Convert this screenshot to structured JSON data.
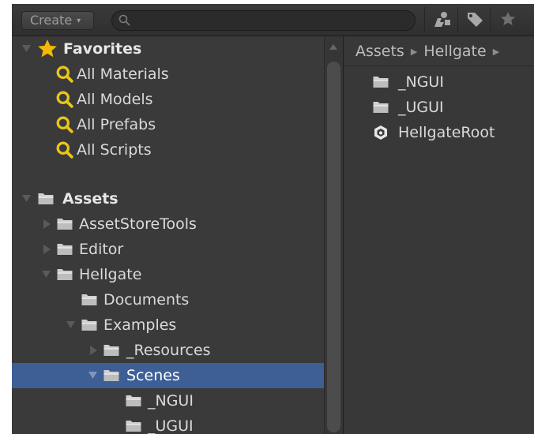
{
  "toolbar": {
    "create_label": "Create",
    "search_placeholder": "",
    "icons": [
      "filter-by-type-icon",
      "label-tag-icon",
      "favorite-star-icon"
    ]
  },
  "favorites": {
    "header": "Favorites",
    "items": [
      {
        "label": "All Materials"
      },
      {
        "label": "All Models"
      },
      {
        "label": "All Prefabs"
      },
      {
        "label": "All Scripts"
      }
    ]
  },
  "assets": {
    "header": "Assets",
    "tree": [
      {
        "label": "AssetStoreTools"
      },
      {
        "label": "Editor"
      },
      {
        "label": "Hellgate"
      },
      {
        "label": "Documents"
      },
      {
        "label": "Examples"
      },
      {
        "label": "_Resources"
      },
      {
        "label": "Scenes",
        "selected": true
      },
      {
        "label": "_NGUI"
      },
      {
        "label": "_UGUI"
      }
    ]
  },
  "breadcrumb": {
    "items": [
      "Assets",
      "Hellgate"
    ]
  },
  "contents": {
    "items": [
      {
        "label": "_NGUI",
        "icon": "folder-icon"
      },
      {
        "label": "_UGUI",
        "icon": "folder-icon"
      },
      {
        "label": "HellgateRoot",
        "icon": "unity-scene-icon"
      }
    ]
  },
  "colors": {
    "selection": "#3d5f95",
    "panel": "#3a3a3a",
    "search_icon_yellow": "#e8c619",
    "star_yellow": "#f5b800"
  }
}
